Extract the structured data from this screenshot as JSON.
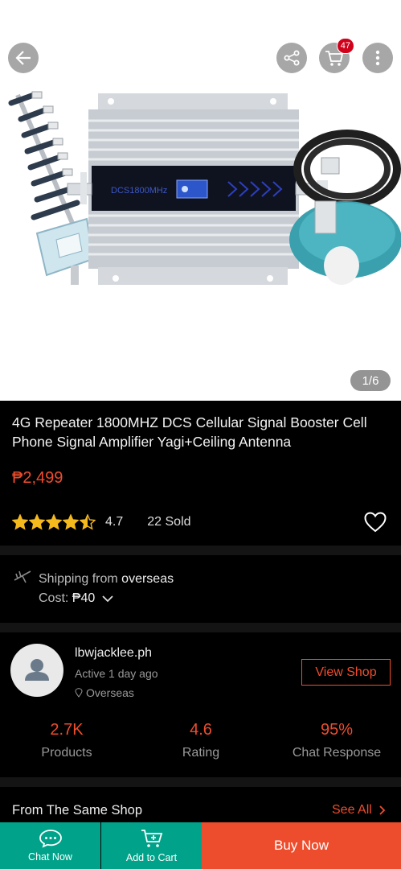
{
  "gallery": {
    "page_indicator": "1/6",
    "cart_count": "47",
    "image_text": "DCS1800MHz",
    "icons": [
      "back-arrow-icon",
      "share-icon",
      "cart-icon",
      "more-icon"
    ]
  },
  "product": {
    "title": "4G Repeater 1800MHZ DCS Cellular Signal Booster Cell Phone Signal Amplifier Yagi+Ceiling Antenna",
    "price": "₱2,499",
    "rating_value": "4.7",
    "rating_stars": 4.5,
    "sold": "22 Sold"
  },
  "shipping": {
    "from_prefix": "Shipping from ",
    "from_value": "overseas",
    "cost_prefix": "Cost: ",
    "cost_value": "₱40"
  },
  "shop": {
    "name": "lbwjacklee.ph",
    "active": "Active 1 day ago",
    "location": "Overseas",
    "view_shop_label": "View Shop",
    "stats": [
      {
        "value": "2.7K",
        "label": "Products"
      },
      {
        "value": "4.6",
        "label": "Rating"
      },
      {
        "value": "95%",
        "label": "Chat Response"
      }
    ]
  },
  "same_shop": {
    "title": "From The Same Shop",
    "see_all": "See All"
  },
  "bottom_bar": {
    "chat_label": "Chat Now",
    "cart_label": "Add to Cart",
    "buy_label": "Buy Now"
  },
  "colors": {
    "accent": "#ee4d2d",
    "teal": "#00a38a",
    "background": "#000000"
  }
}
